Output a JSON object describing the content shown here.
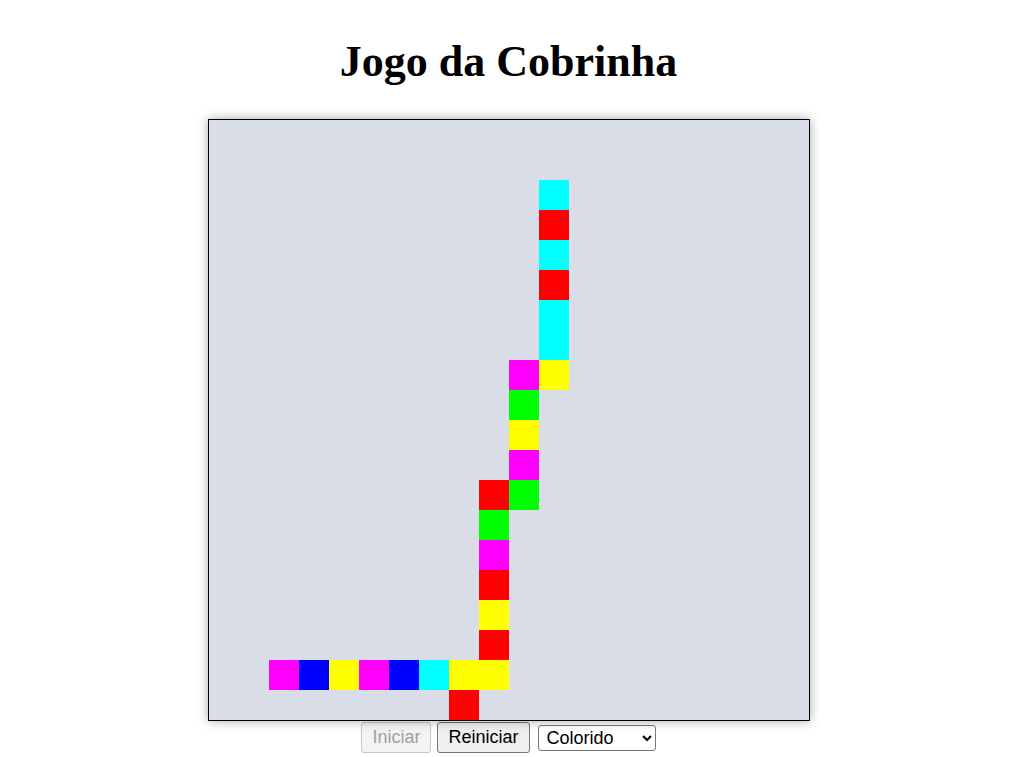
{
  "title": "Jogo da Cobrinha",
  "board": {
    "columns": 20,
    "rows": 20
  },
  "snake": [
    {
      "col": 11,
      "row": 2,
      "color": "#00ffff"
    },
    {
      "col": 11,
      "row": 3,
      "color": "#ff0000"
    },
    {
      "col": 11,
      "row": 4,
      "color": "#00ffff"
    },
    {
      "col": 11,
      "row": 5,
      "color": "#ff0000"
    },
    {
      "col": 11,
      "row": 6,
      "color": "#00ffff"
    },
    {
      "col": 11,
      "row": 7,
      "color": "#00ffff"
    },
    {
      "col": 11,
      "row": 8,
      "color": "#ffff00"
    },
    {
      "col": 10,
      "row": 8,
      "color": "#ff00ff"
    },
    {
      "col": 10,
      "row": 9,
      "color": "#00ff00"
    },
    {
      "col": 10,
      "row": 10,
      "color": "#ffff00"
    },
    {
      "col": 10,
      "row": 11,
      "color": "#ff00ff"
    },
    {
      "col": 10,
      "row": 12,
      "color": "#00ff00"
    },
    {
      "col": 9,
      "row": 12,
      "color": "#ff0000"
    },
    {
      "col": 9,
      "row": 13,
      "color": "#00ff00"
    },
    {
      "col": 9,
      "row": 14,
      "color": "#ff00ff"
    },
    {
      "col": 9,
      "row": 15,
      "color": "#ff0000"
    },
    {
      "col": 9,
      "row": 16,
      "color": "#ffff00"
    },
    {
      "col": 9,
      "row": 17,
      "color": "#ff0000"
    },
    {
      "col": 9,
      "row": 18,
      "color": "#ffff00"
    },
    {
      "col": 8,
      "row": 18,
      "color": "#ffff00"
    },
    {
      "col": 7,
      "row": 18,
      "color": "#00ffff"
    },
    {
      "col": 6,
      "row": 18,
      "color": "#0000ff"
    },
    {
      "col": 5,
      "row": 18,
      "color": "#ff00ff"
    },
    {
      "col": 4,
      "row": 18,
      "color": "#ffff00"
    },
    {
      "col": 3,
      "row": 18,
      "color": "#0000ff"
    },
    {
      "col": 2,
      "row": 18,
      "color": "#ff00ff"
    },
    {
      "col": 8,
      "row": 19,
      "color": "#ff0000"
    }
  ],
  "buttons": [
    {
      "label": "Iniciar",
      "disabled": true
    },
    {
      "label": "Reiniciar",
      "disabled": false
    }
  ],
  "mode_select": {
    "value": "Colorido"
  }
}
